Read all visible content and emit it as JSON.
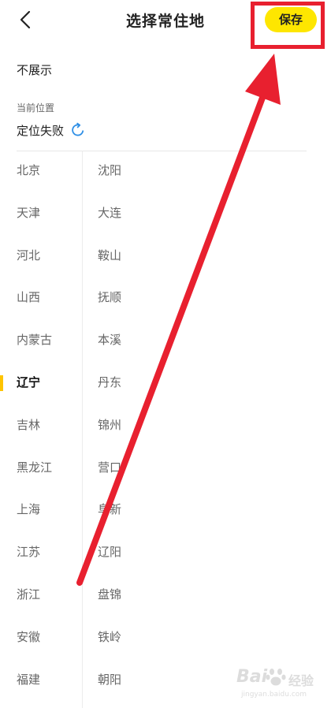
{
  "header": {
    "title": "选择常住地",
    "save_label": "保存"
  },
  "no_display_label": "不展示",
  "current_location": {
    "label": "当前位置",
    "status": "定位失败"
  },
  "provinces": [
    "北京",
    "天津",
    "河北",
    "山西",
    "内蒙古",
    "辽宁",
    "吉林",
    "黑龙江",
    "上海",
    "江苏",
    "浙江",
    "安徽",
    "福建"
  ],
  "selected_province": "辽宁",
  "cities": [
    "沈阳",
    "大连",
    "鞍山",
    "抚顺",
    "本溪",
    "丹东",
    "锦州",
    "营口",
    "阜新",
    "辽阳",
    "盘锦",
    "铁岭",
    "朝阳"
  ],
  "watermark": {
    "brand_a": "Bai",
    "brand_b": "经验",
    "url": "jingyan.baidu.com"
  },
  "colors": {
    "save_button": "#FEE600",
    "selected_indicator": "#FEC400",
    "annotation_red": "#E8202F",
    "refresh_icon": "#2E8FE6"
  },
  "icons": {
    "back": "chevron-left-icon",
    "refresh": "refresh-icon"
  }
}
